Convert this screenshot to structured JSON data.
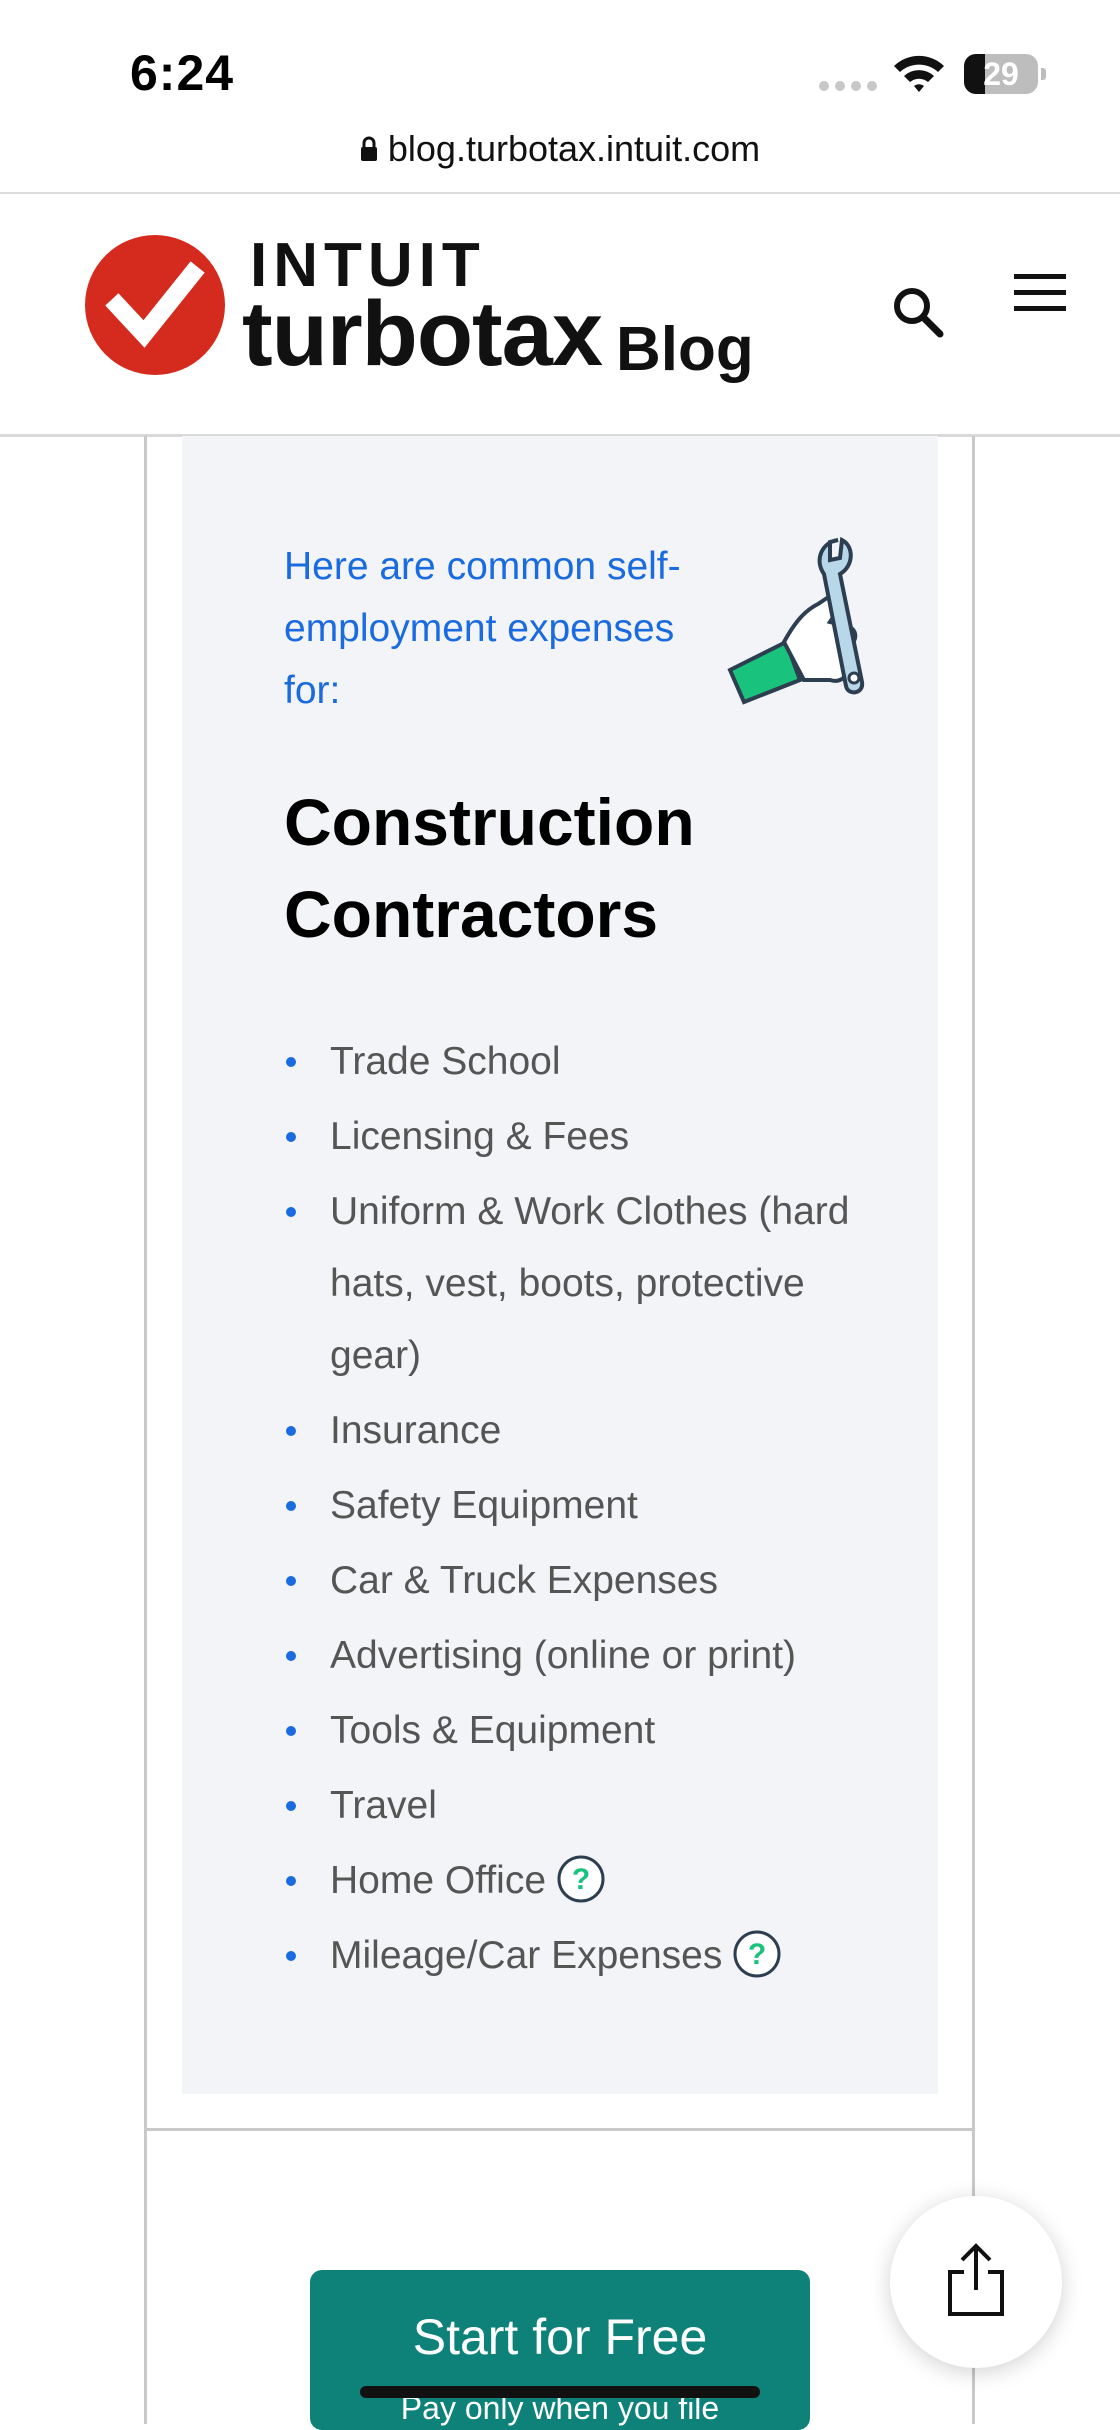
{
  "status_bar": {
    "time": "6:24",
    "battery_level": "29",
    "battery_fraction": 0.29
  },
  "browser": {
    "url": "blog.turbotax.intuit.com"
  },
  "header": {
    "brand_top": "INTUIT",
    "brand_main": "turbotax",
    "brand_suffix": "Blog",
    "accent_color": "#d52b1e",
    "icons": [
      "search-icon",
      "menu-icon"
    ]
  },
  "card": {
    "intro": "Here are common self-employment expenses for:",
    "title": "Construction Contractors",
    "items": [
      {
        "label": "Trade School",
        "help": false
      },
      {
        "label": "Licensing & Fees",
        "help": false
      },
      {
        "label": "Uniform & Work Clothes (hard hats, vest, boots, protective gear)",
        "help": false
      },
      {
        "label": "Insurance",
        "help": false
      },
      {
        "label": "Safety Equipment",
        "help": false
      },
      {
        "label": "Car & Truck Expenses",
        "help": false
      },
      {
        "label": "Advertising (online or print)",
        "help": false
      },
      {
        "label": "Tools & Equipment",
        "help": false
      },
      {
        "label": "Travel",
        "help": false
      },
      {
        "label": "Home Office",
        "help": true
      },
      {
        "label": "Mileage/Car Expenses",
        "help": true
      }
    ],
    "link_color": "#1a6be0",
    "help_icon_glyph": "?"
  },
  "cta": {
    "label": "Start for Free",
    "sublabel": "Pay only when you file",
    "color": "#0e8279"
  },
  "share": {
    "icon": "share-icon"
  }
}
